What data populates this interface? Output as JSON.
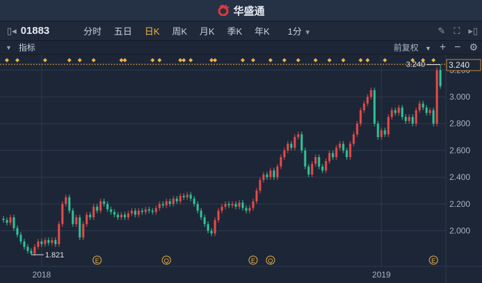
{
  "header": {
    "brand": "华盛通"
  },
  "toolbar": {
    "code": "01883",
    "tabs": [
      "分时",
      "五日",
      "日K",
      "周K",
      "月K",
      "季K",
      "年K"
    ],
    "active_tab": "日K",
    "interval": "1分"
  },
  "indicator_bar": {
    "label": "指标",
    "adjust": "前复权"
  },
  "colors": {
    "up": "#e94b4b",
    "down": "#2fc59a",
    "accent": "#f0b44a",
    "grid": "#2c3a4f"
  },
  "chart_data": {
    "type": "candlestick",
    "ylim": [
      1.78,
      3.28
    ],
    "yticks": [
      "3.200",
      "3.000",
      "2.800",
      "2.600",
      "2.400",
      "2.200",
      "2.000"
    ],
    "ytick_values": [
      3.2,
      3.0,
      2.8,
      2.6,
      2.4,
      2.2,
      2.0
    ],
    "current_price": "3.240",
    "high_label": "3.240",
    "low_label": "1.821",
    "low_value": 1.821,
    "high_value": 3.24,
    "xticks": [
      {
        "label": "2018",
        "index": 11
      },
      {
        "label": "2019",
        "index": 109
      }
    ],
    "events": [
      {
        "label": "E",
        "index": 27
      },
      {
        "label": "Q",
        "index": 47
      },
      {
        "label": "E",
        "index": 72
      },
      {
        "label": "Q",
        "index": 77
      },
      {
        "label": "E",
        "index": 124
      }
    ],
    "event_dots": [
      1,
      4,
      12,
      19,
      22,
      26,
      34,
      35,
      43,
      45,
      51,
      52,
      54,
      60,
      61,
      69,
      72,
      77,
      81,
      85,
      90,
      94,
      98,
      103,
      105,
      110,
      118,
      121,
      124
    ],
    "close": [
      2.08,
      2.06,
      2.1,
      2.02,
      1.97,
      1.92,
      1.88,
      1.85,
      1.83,
      1.88,
      1.92,
      1.9,
      1.93,
      1.91,
      1.93,
      1.9,
      2.05,
      2.2,
      2.25,
      2.15,
      2.05,
      2.1,
      1.95,
      2.05,
      2.12,
      2.1,
      2.18,
      2.15,
      2.22,
      2.2,
      2.16,
      2.14,
      2.12,
      2.1,
      2.12,
      2.1,
      2.13,
      2.15,
      2.12,
      2.15,
      2.14,
      2.16,
      2.15,
      2.14,
      2.17,
      2.2,
      2.19,
      2.22,
      2.2,
      2.24,
      2.22,
      2.26,
      2.25,
      2.27,
      2.24,
      2.2,
      2.15,
      2.1,
      2.05,
      2.0,
      1.98,
      2.08,
      2.15,
      2.18,
      2.2,
      2.19,
      2.2,
      2.18,
      2.21,
      2.17,
      2.15,
      2.17,
      2.22,
      2.3,
      2.38,
      2.42,
      2.4,
      2.45,
      2.4,
      2.48,
      2.55,
      2.6,
      2.65,
      2.62,
      2.7,
      2.72,
      2.6,
      2.48,
      2.42,
      2.5,
      2.55,
      2.48,
      2.45,
      2.52,
      2.58,
      2.55,
      2.62,
      2.65,
      2.6,
      2.55,
      2.65,
      2.72,
      2.8,
      2.9,
      2.95,
      3.0,
      3.05,
      2.8,
      2.7,
      2.75,
      2.72,
      2.85,
      2.9,
      2.88,
      2.92,
      2.85,
      2.82,
      2.85,
      2.8,
      2.9,
      2.95,
      2.92,
      2.88,
      2.9,
      2.8,
      3.2,
      3.08
    ]
  }
}
